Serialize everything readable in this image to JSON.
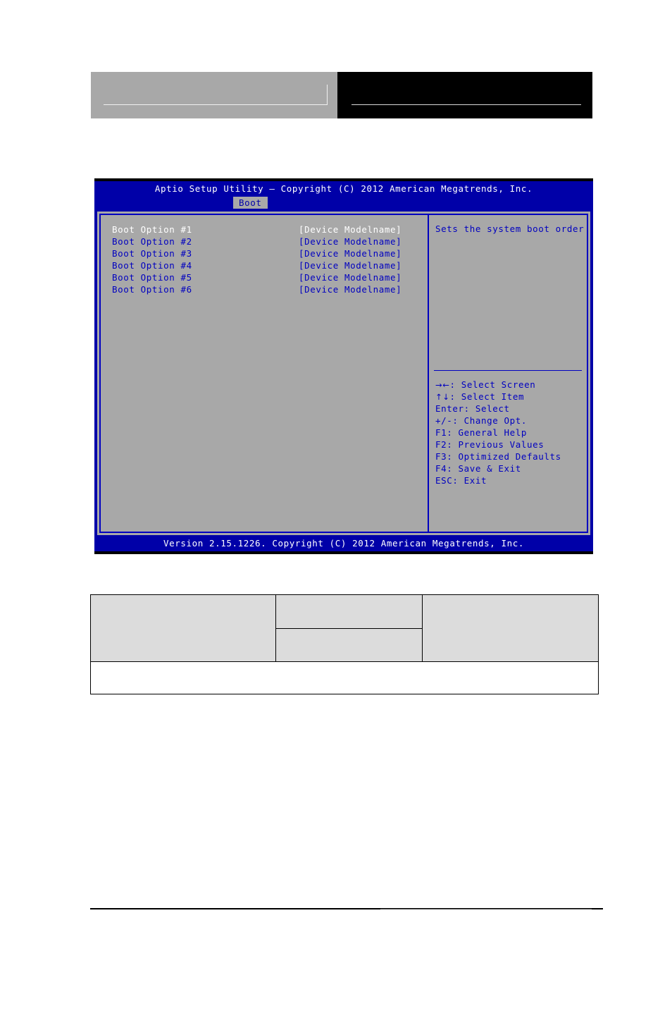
{
  "header": {
    "left_box": {
      "label": "document-header-left-block"
    },
    "right_box": {
      "label": "document-header-right-block"
    }
  },
  "bios": {
    "title": "Aptio Setup Utility – Copyright (C) 2012 American Megatrends, Inc.",
    "active_tab": "Boot",
    "tabs": [
      "Boot"
    ],
    "boot_options": [
      {
        "label": "Boot Option #1",
        "value": "[Device Modelname]",
        "selected": true
      },
      {
        "label": "Boot Option #2",
        "value": "[Device Modelname]",
        "selected": false
      },
      {
        "label": "Boot Option #3",
        "value": "[Device Modelname]",
        "selected": false
      },
      {
        "label": "Boot Option #4",
        "value": "[Device Modelname]",
        "selected": false
      },
      {
        "label": "Boot Option #5",
        "value": "[Device Modelname]",
        "selected": false
      },
      {
        "label": "Boot Option #6",
        "value": "[Device Modelname]",
        "selected": false
      }
    ],
    "help": {
      "description": "Sets the system boot order"
    },
    "keys": [
      {
        "glyph": "→←",
        "text": ": Select Screen"
      },
      {
        "glyph": "↑↓",
        "text": ": Select Item"
      },
      {
        "glyph": "",
        "text": "Enter: Select"
      },
      {
        "glyph": "",
        "text": "+/-: Change Opt."
      },
      {
        "glyph": "",
        "text": "F1: General Help"
      },
      {
        "glyph": "",
        "text": "F2: Previous Values"
      },
      {
        "glyph": "",
        "text": "F3: Optimized Defaults"
      },
      {
        "glyph": "",
        "text": "F4: Save & Exit"
      },
      {
        "glyph": "",
        "text": "ESC: Exit"
      }
    ],
    "footer": "Version 2.15.1226. Copyright (C) 2012 American Megatrends, Inc.",
    "colors": {
      "screen_bg": "#0000a8",
      "pane_bg": "#a8a8a8",
      "text_blue": "#0000c0",
      "text_white": "#ffffff"
    }
  },
  "table": {
    "rows": [
      {
        "cells": [
          {
            "text": "",
            "shade": "gray"
          },
          {
            "text": "",
            "shade": "gray"
          },
          {
            "text": "",
            "shade": "gray"
          }
        ]
      },
      {
        "cells": [
          {
            "text": "",
            "shade": "gray"
          }
        ]
      },
      {
        "cells": [
          {
            "text": "",
            "shade": "white"
          }
        ]
      }
    ]
  }
}
